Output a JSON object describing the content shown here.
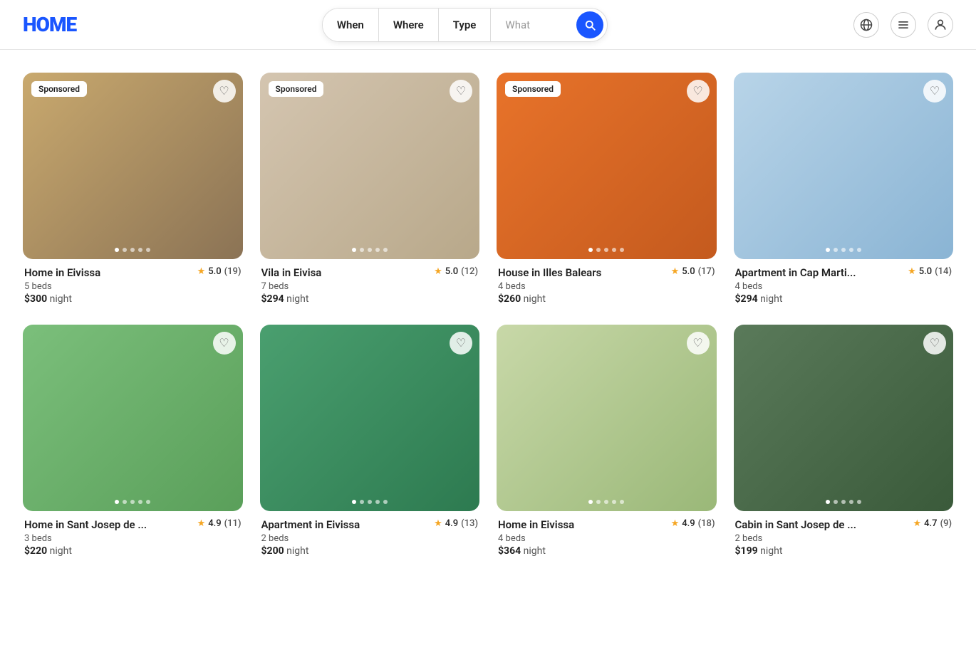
{
  "header": {
    "logo": "HOME",
    "search": {
      "when_label": "When",
      "where_label": "Where",
      "type_label": "Type",
      "what_placeholder": "What"
    }
  },
  "listings": [
    {
      "id": 1,
      "title": "Home in Eivissa",
      "sponsored": true,
      "rating": "5.0",
      "reviews": "(19)",
      "beds": "5 beds",
      "price": "$300",
      "per": "night",
      "dots": 5,
      "active_dot": 0,
      "bg": "bg-1"
    },
    {
      "id": 2,
      "title": "Vila in Eivisa",
      "sponsored": true,
      "rating": "5.0",
      "reviews": "(12)",
      "beds": "7 beds",
      "price": "$294",
      "per": "night",
      "dots": 5,
      "active_dot": 0,
      "bg": "bg-2"
    },
    {
      "id": 3,
      "title": "House in Illes Balears",
      "sponsored": true,
      "rating": "5.0",
      "reviews": "(17)",
      "beds": "4 beds",
      "price": "$260",
      "per": "night",
      "dots": 5,
      "active_dot": 0,
      "bg": "bg-3"
    },
    {
      "id": 4,
      "title": "Apartment in Cap Marti...",
      "sponsored": false,
      "rating": "5.0",
      "reviews": "(14)",
      "beds": "4 beds",
      "price": "$294",
      "per": "night",
      "dots": 5,
      "active_dot": 0,
      "bg": "bg-4"
    },
    {
      "id": 5,
      "title": "Home in Sant Josep de ...",
      "sponsored": false,
      "rating": "4.9",
      "reviews": "(11)",
      "beds": "3 beds",
      "price": "$220",
      "per": "night",
      "dots": 5,
      "active_dot": 0,
      "bg": "bg-5"
    },
    {
      "id": 6,
      "title": "Apartment in Eivissa",
      "sponsored": false,
      "rating": "4.9",
      "reviews": "(13)",
      "beds": "2 beds",
      "price": "$200",
      "per": "night",
      "dots": 5,
      "active_dot": 0,
      "bg": "bg-6"
    },
    {
      "id": 7,
      "title": "Home in Eivissa",
      "sponsored": false,
      "rating": "4.9",
      "reviews": "(18)",
      "beds": "4 beds",
      "price": "$364",
      "per": "night",
      "dots": 5,
      "active_dot": 0,
      "bg": "bg-7"
    },
    {
      "id": 8,
      "title": "Cabin in Sant Josep de ...",
      "sponsored": false,
      "rating": "4.7",
      "reviews": "(9)",
      "beds": "2 beds",
      "price": "$199",
      "per": "night",
      "dots": 5,
      "active_dot": 0,
      "bg": "bg-8"
    }
  ],
  "labels": {
    "sponsored": "Sponsored",
    "night": "night"
  }
}
